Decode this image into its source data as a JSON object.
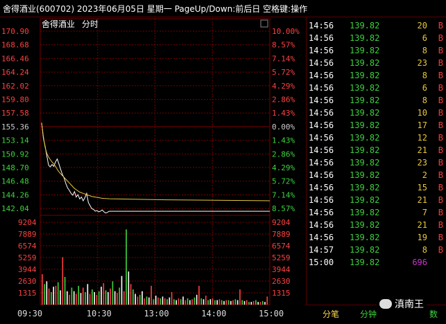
{
  "title_text": "舍得酒业(600702) 2023年06月05日 星期一 PageUp/Down:前后日 空格键:操作",
  "chart_header": {
    "name": "舍得酒业",
    "mode": "分时"
  },
  "price_axis": {
    "left": [
      "170.90",
      "168.68",
      "166.46",
      "164.24",
      "162.02",
      "159.80",
      "157.58",
      "155.36",
      "153.14",
      "150.92",
      "148.70",
      "146.48",
      "144.26",
      "142.04"
    ],
    "right": [
      "10.00%",
      "8.57%",
      "7.14%",
      "5.72%",
      "4.29%",
      "2.86%",
      "1.43%",
      "0.00%",
      "1.43%",
      "2.86%",
      "4.29%",
      "5.72%",
      "7.14%",
      "8.57%"
    ],
    "colors": [
      "#ff4040",
      "#ff4040",
      "#ff4040",
      "#ff4040",
      "#ff4040",
      "#ff4040",
      "#ff4040",
      "#cccccc",
      "#3dd23d",
      "#3dd23d",
      "#3dd23d",
      "#3dd23d",
      "#3dd23d",
      "#3dd23d"
    ]
  },
  "volume_axis": {
    "left": [
      "9204",
      "7889",
      "6574",
      "5259",
      "3944",
      "2630",
      "1315"
    ],
    "right": [
      "9204",
      "7889",
      "6574",
      "5259",
      "3944",
      "2630",
      "1315"
    ]
  },
  "time_axis": [
    "09:30",
    "10:30",
    "13:00",
    "14:00",
    "15:00"
  ],
  "chart_data": {
    "type": "line",
    "price_series": [
      156.0,
      153.5,
      152.2,
      150.6,
      149.1,
      148.8,
      149.2,
      148.9,
      149.6,
      150.1,
      149.3,
      148.4,
      147.6,
      147.0,
      146.1,
      145.4,
      145.0,
      144.5,
      144.2,
      144.8,
      143.9,
      144.3,
      143.6,
      143.9,
      143.3,
      143.8,
      144.5,
      143.0,
      142.5,
      142.0,
      141.9,
      141.6,
      141.7,
      141.5,
      141.6,
      141.8,
      141.5,
      141.3,
      141.4,
      141.6
    ],
    "avg_series": [
      156.0,
      153.8,
      152.0,
      151.0,
      150.4,
      150.0,
      149.6,
      149.3,
      148.9,
      148.4,
      148.0,
      147.7,
      147.4,
      147.1,
      146.8,
      146.5,
      146.2,
      145.9,
      145.6,
      145.3,
      145.1,
      144.9,
      144.7,
      144.6,
      144.5,
      144.4,
      144.3,
      144.2,
      144.1,
      144.0,
      143.95,
      143.9,
      143.85,
      143.8,
      143.75,
      143.7,
      143.68,
      143.66,
      143.64,
      143.62
    ],
    "volume": [
      3400,
      2300,
      2600,
      1800,
      1400,
      2000,
      2100,
      2500,
      1600,
      5300,
      3100,
      1500,
      1100,
      1900,
      1500,
      1200,
      2100,
      1300,
      1900,
      1400,
      2300,
      1200,
      1700,
      1400,
      1100,
      1500,
      2000,
      2400,
      1600,
      1400,
      1800,
      2600,
      1500,
      1300,
      1900,
      3200,
      1500,
      8400,
      3700,
      2300,
      1700,
      1200,
      900,
      1100,
      1500,
      700,
      900,
      800,
      2100,
      600,
      1000,
      800,
      700,
      900,
      700,
      600,
      800,
      1400,
      600,
      500,
      700,
      600,
      900,
      500,
      700,
      500,
      600,
      800,
      1100,
      2100,
      700,
      600,
      1000,
      500,
      600,
      700,
      500,
      500,
      600,
      500,
      400,
      500,
      500,
      400,
      500,
      600,
      500,
      1700,
      500,
      400,
      500,
      300,
      300,
      400,
      500,
      300,
      300,
      400,
      300,
      900
    ],
    "vol_max": 9204,
    "last_price": 141.32
  },
  "ticks": [
    {
      "time": "14:56",
      "price": "139.82",
      "vol": "20",
      "flag": "B"
    },
    {
      "time": "14:56",
      "price": "139.82",
      "vol": "6",
      "flag": "B"
    },
    {
      "time": "14:56",
      "price": "139.82",
      "vol": "8",
      "flag": "B"
    },
    {
      "time": "14:56",
      "price": "139.82",
      "vol": "23",
      "flag": "B"
    },
    {
      "time": "14:56",
      "price": "139.82",
      "vol": "8",
      "flag": "B"
    },
    {
      "time": "14:56",
      "price": "139.82",
      "vol": "6",
      "flag": "B"
    },
    {
      "time": "14:56",
      "price": "139.82",
      "vol": "8",
      "flag": "B"
    },
    {
      "time": "14:56",
      "price": "139.82",
      "vol": "10",
      "flag": "B"
    },
    {
      "time": "14:56",
      "price": "139.82",
      "vol": "17",
      "flag": "B"
    },
    {
      "time": "14:56",
      "price": "139.82",
      "vol": "12",
      "flag": "B"
    },
    {
      "time": "14:56",
      "price": "139.82",
      "vol": "21",
      "flag": "B"
    },
    {
      "time": "14:56",
      "price": "139.82",
      "vol": "23",
      "flag": "B"
    },
    {
      "time": "14:56",
      "price": "139.82",
      "vol": "2",
      "flag": "B"
    },
    {
      "time": "14:56",
      "price": "139.82",
      "vol": "15",
      "flag": "B"
    },
    {
      "time": "14:56",
      "price": "139.82",
      "vol": "21",
      "flag": "B"
    },
    {
      "time": "14:56",
      "price": "139.82",
      "vol": "7",
      "flag": "B"
    },
    {
      "time": "14:56",
      "price": "139.82",
      "vol": "21",
      "flag": "B"
    },
    {
      "time": "14:56",
      "price": "139.82",
      "vol": "19",
      "flag": "B"
    },
    {
      "time": "14:57",
      "price": "139.82",
      "vol": "8",
      "flag": "B"
    },
    {
      "time": "15:00",
      "price": "139.82",
      "vol": "696",
      "flag": ""
    }
  ],
  "tabs": [
    "分笔",
    "分钟",
    "数"
  ],
  "brand": "滇南王",
  "colors": {
    "up": "#ff4040",
    "down": "#3dd23d",
    "avg": "#e8c73a",
    "price_line": "#ffffff",
    "grid": "#7a0000",
    "last_vol": "#cc33cc"
  }
}
